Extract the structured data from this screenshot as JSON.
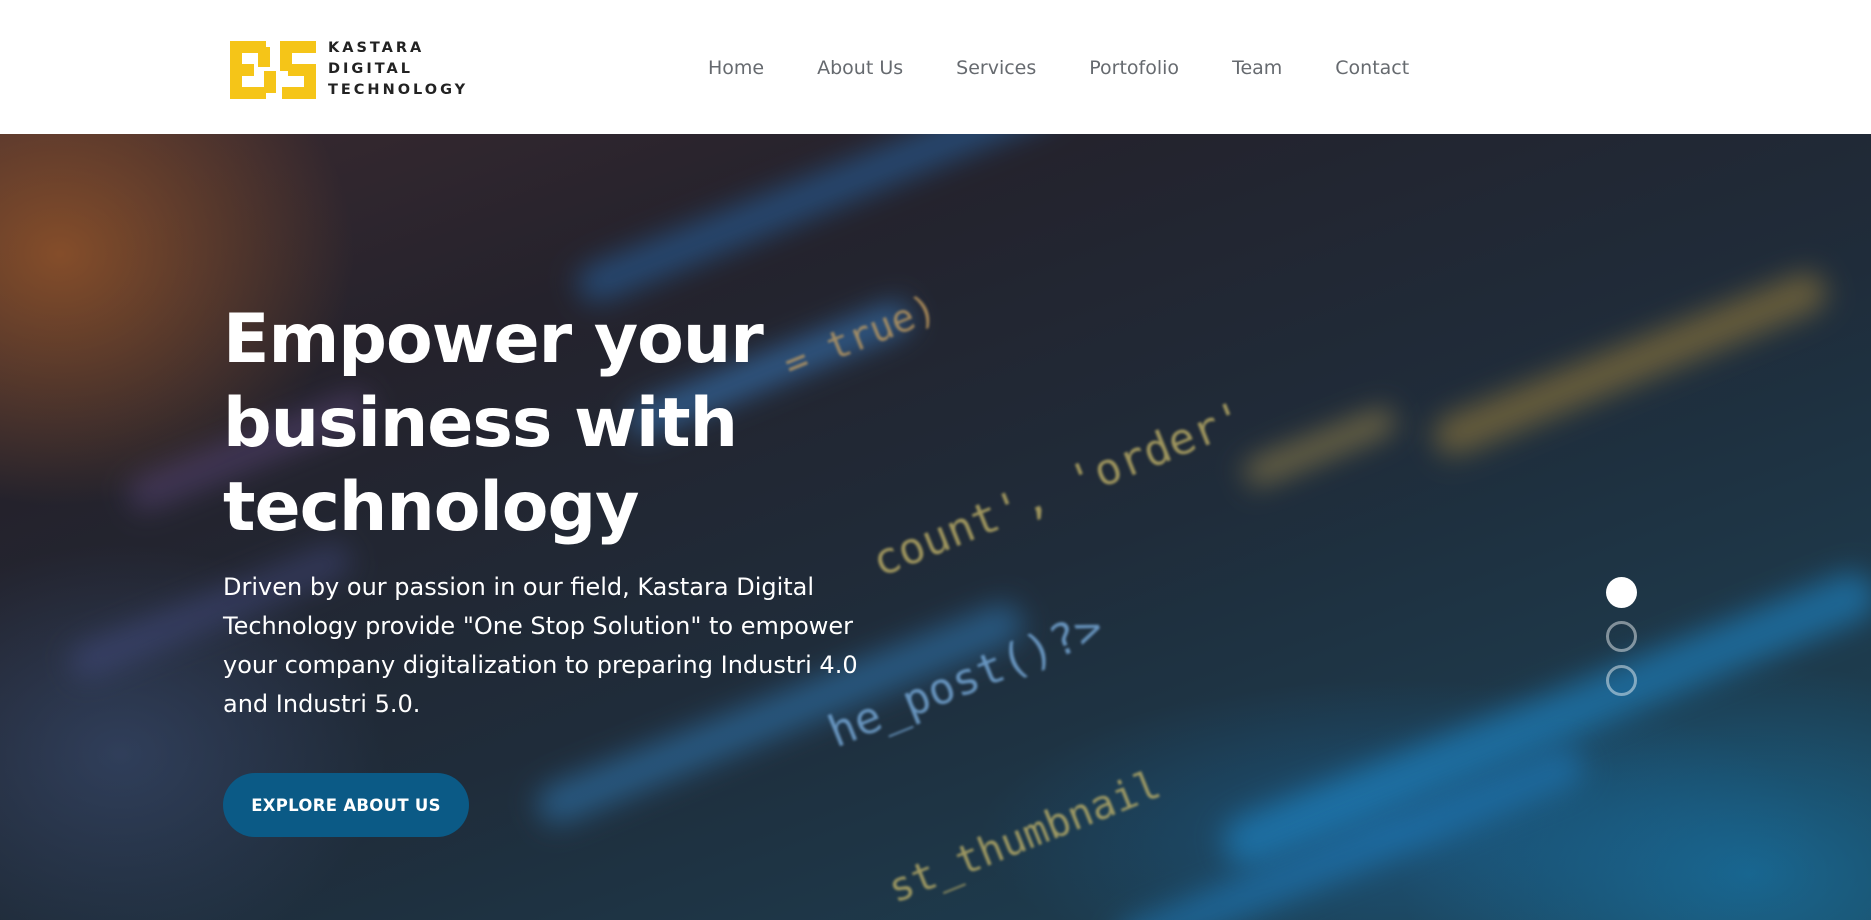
{
  "brand": {
    "logo_line1": "KASTARA",
    "logo_line2": "DIGITAL",
    "logo_line3": "TECHNOLOGY",
    "logo_color": "#f5c518"
  },
  "nav": {
    "items": [
      {
        "label": "Home"
      },
      {
        "label": "About Us"
      },
      {
        "label": "Services"
      },
      {
        "label": "Portofolio"
      },
      {
        "label": "Team"
      },
      {
        "label": "Contact"
      }
    ]
  },
  "hero": {
    "title_line1": "Empower your",
    "title_line2": "business with",
    "title_line3": "technology",
    "description": "Driven by our passion in our field, Kastara Digital Technology provide \"One Stop Solution\" to empower your company digitalization to preparing Industri 4.0 and Industri 5.0.",
    "cta_label": "EXPLORE ABOUT US",
    "cta_color": "#0b5a86"
  },
  "slider": {
    "count": 3,
    "active_index": 0
  }
}
